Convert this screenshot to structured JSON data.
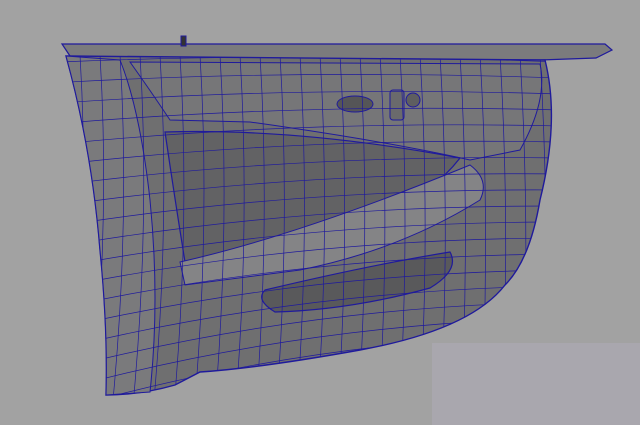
{
  "viewport": {
    "background_color": "#a2a2a2",
    "model_fill_color": "#6f6f70",
    "model_shade_color": "#5a5a5c",
    "model_highlight_color": "#8a8a8c",
    "wire_color": "#1f1a9c",
    "corner_patch_color": "#a9a7ae"
  }
}
